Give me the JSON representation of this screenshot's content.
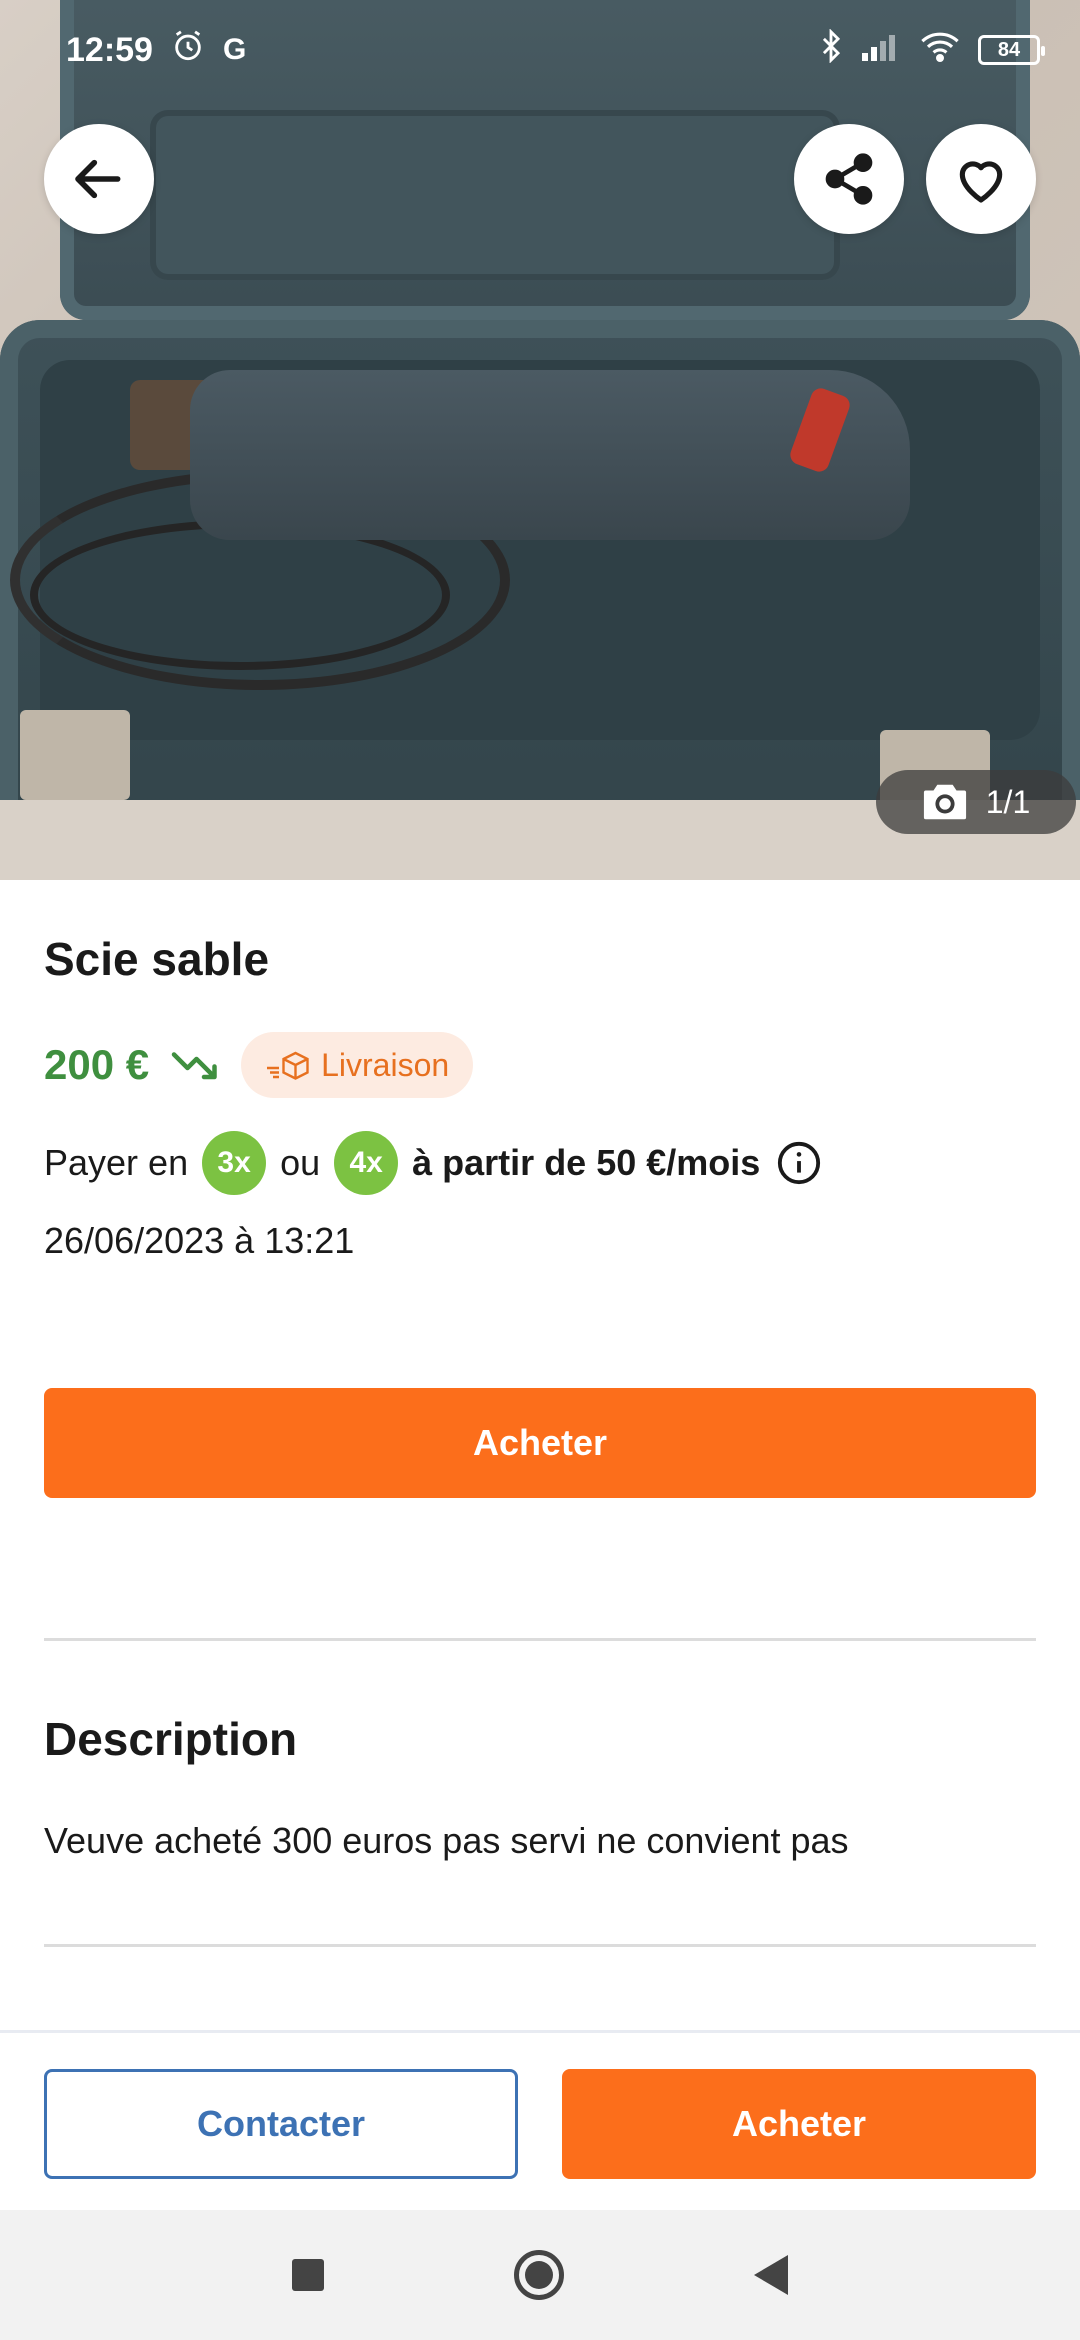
{
  "status_bar": {
    "time": "12:59",
    "alarm_icon": "alarm-icon",
    "g_label": "G",
    "battery_level": "84"
  },
  "hero": {
    "photo_counter": "1/1"
  },
  "listing": {
    "title": "Scie sable",
    "price": "200 €",
    "delivery_label": "Livraison",
    "pay_prefix": "Payer en",
    "pay_option_1": "3x",
    "pay_or": "ou",
    "pay_option_2": "4x",
    "pay_suffix": "à partir de 50 €/mois",
    "date": "26/06/2023 à 13:21",
    "buy_label": "Acheter"
  },
  "description": {
    "title": "Description",
    "text": "Veuve acheté 300 euros pas servi ne convient pas"
  },
  "action_bar": {
    "contact_label": "Contacter",
    "buy_label": "Acheter"
  },
  "colors": {
    "accent_orange": "#fc6e1b",
    "price_green": "#3f8f3f",
    "contact_blue": "#3d72b4",
    "pay_badge_green": "#7cc242"
  }
}
